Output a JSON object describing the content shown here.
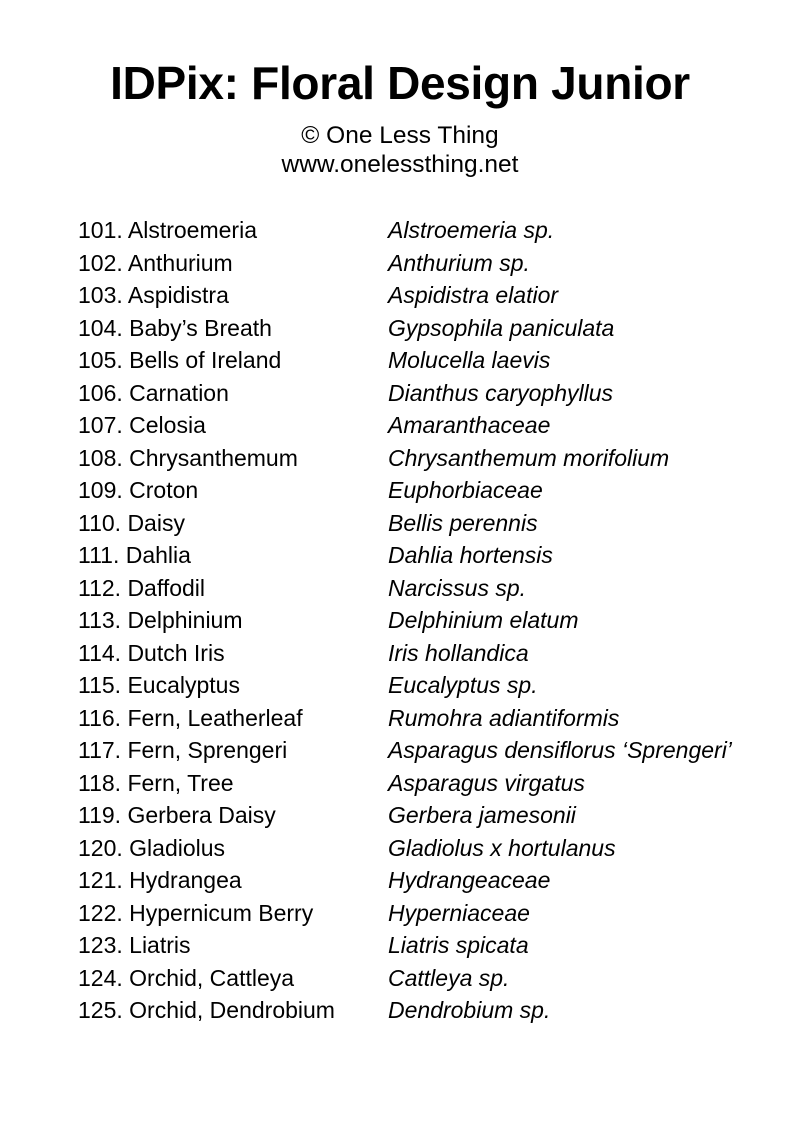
{
  "header": {
    "title": "IDPix: Floral Design Junior",
    "copyright": "© One Less Thing",
    "website": "www.onelessthing.net"
  },
  "list": {
    "rows": [
      {
        "common": "101. Alstroemeria",
        "scientific": "Alstroemeria sp."
      },
      {
        "common": "102. Anthurium",
        "scientific": "Anthurium sp."
      },
      {
        "common": "103. Aspidistra",
        "scientific": "Aspidistra elatior"
      },
      {
        "common": "104. Baby’s Breath",
        "scientific": "Gypsophila paniculata"
      },
      {
        "common": "105. Bells of Ireland",
        "scientific": "Molucella laevis"
      },
      {
        "common": "106. Carnation",
        "scientific": "Dianthus caryophyllus"
      },
      {
        "common": "107. Celosia",
        "scientific": "Amaranthaceae"
      },
      {
        "common": "108. Chrysanthemum",
        "scientific": "Chrysanthemum morifolium"
      },
      {
        "common": "109. Croton",
        "scientific": "Euphorbiaceae"
      },
      {
        "common": "110. Daisy",
        "scientific": "Bellis perennis"
      },
      {
        "common": "111. Dahlia",
        "scientific": "Dahlia hortensis"
      },
      {
        "common": "112. Daffodil",
        "scientific": "Narcissus sp."
      },
      {
        "common": "113. Delphinium",
        "scientific": "Delphinium elatum"
      },
      {
        "common": "114. Dutch Iris",
        "scientific": "Iris hollandica"
      },
      {
        "common": "115. Eucalyptus",
        "scientific": "Eucalyptus sp."
      },
      {
        "common": "116. Fern, Leatherleaf",
        "scientific": "Rumohra adiantiformis"
      },
      {
        "common": "117. Fern, Sprengeri",
        "scientific": "Asparagus densiflorus ‘Sprengeri’"
      },
      {
        "common": "118. Fern, Tree",
        "scientific": "Asparagus virgatus"
      },
      {
        "common": "119. Gerbera Daisy",
        "scientific": "Gerbera jamesonii"
      },
      {
        "common": "120. Gladiolus",
        "scientific": "Gladiolus x hortulanus"
      },
      {
        "common": "121. Hydrangea",
        "scientific": "Hydrangeaceae"
      },
      {
        "common": "122. Hypernicum Berry",
        "scientific": "Hyperniaceae"
      },
      {
        "common": "123. Liatris",
        "scientific": "Liatris spicata"
      },
      {
        "common": "124. Orchid, Cattleya",
        "scientific": "Cattleya sp."
      },
      {
        "common": "125. Orchid, Dendrobium",
        "scientific": "Dendrobium sp."
      }
    ]
  }
}
